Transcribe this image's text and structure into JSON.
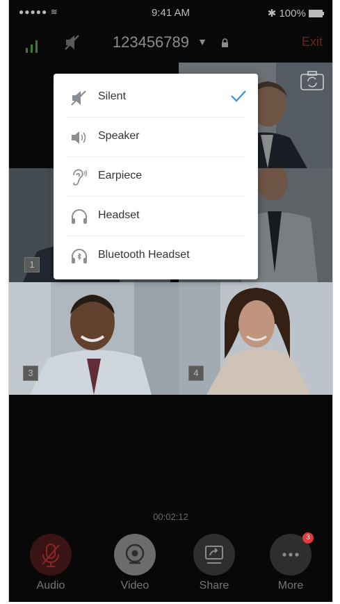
{
  "status_bar": {
    "carrier": "●●●●● ≋",
    "time": "9:41 AM",
    "battery": "✱ 100%"
  },
  "header": {
    "meeting_id": "123456789",
    "exit_label": "Exit"
  },
  "tiles": [
    {
      "number": "1"
    },
    {
      "number": "3"
    },
    {
      "number": "4"
    }
  ],
  "audio_menu": {
    "items": [
      {
        "label": "Silent",
        "icon": "speaker-muted-icon",
        "selected": true
      },
      {
        "label": "Speaker",
        "icon": "speaker-icon",
        "selected": false
      },
      {
        "label": "Earpiece",
        "icon": "ear-icon",
        "selected": false
      },
      {
        "label": "Headset",
        "icon": "headphones-icon",
        "selected": false
      },
      {
        "label": "Bluetooth Headset",
        "icon": "bluetooth-headphones-icon",
        "selected": false
      }
    ]
  },
  "timer": "00:02:12",
  "toolbar": {
    "audio_label": "Audio",
    "video_label": "Video",
    "share_label": "Share",
    "more_label": "More",
    "more_badge": "3"
  },
  "colors": {
    "accent": "#3a8ee6",
    "exit": "#a03030",
    "badge": "#e03c3c"
  }
}
